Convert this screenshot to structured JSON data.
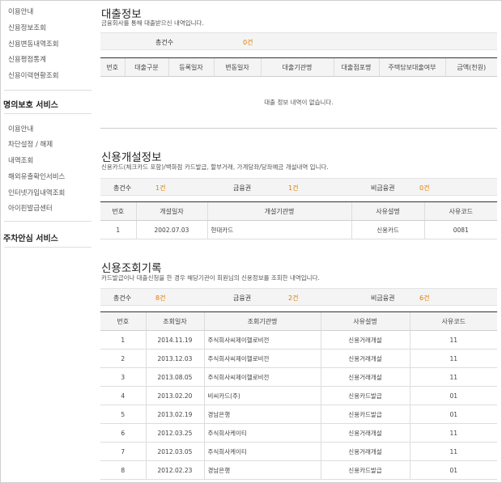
{
  "sidebar": {
    "items_top": [
      "이용안내",
      "신용정보조회",
      "신용변동내역조회",
      "신용평점통계",
      "신용이력현황조회"
    ],
    "section2_title": "명의보호 서비스",
    "items_mid": [
      "이용안내",
      "차단설정 / 해제",
      "내역조회",
      "해외유출확인서비스",
      "인터넷가입내역조회",
      "아이핀발급센터"
    ],
    "section3_title": "주차안심 서비스"
  },
  "loan": {
    "title": "대출정보",
    "desc": "금융회사를 통해 대출받으신 내역입니다.",
    "total_label": "총건수",
    "total_value": "0건",
    "headers": [
      "번호",
      "대출구분",
      "등록일자",
      "변동일자",
      "대출기관명",
      "대출점포명",
      "주택담보대출여부",
      "금액(천원)"
    ],
    "empty_text": "대출 정보 내역이 없습니다."
  },
  "account": {
    "title": "신용개설정보",
    "desc": "신용카드(체크카드 포함)/백화점 카드발급, 할부거래, 가계당좌/당좌예금 개설내역 입니다.",
    "total_label": "총건수",
    "total_value": "1건",
    "fin_label": "금융권",
    "fin_value": "1건",
    "nonfin_label": "비금융권",
    "nonfin_value": "0건",
    "headers": [
      "번호",
      "개설일자",
      "개설기관명",
      "사유설명",
      "사유코드"
    ],
    "rows": [
      [
        "1",
        "2002.07.03",
        "현대카드",
        "신용카드",
        "0081"
      ]
    ]
  },
  "inquiry": {
    "title": "신용조회기록",
    "desc": "카드발급이나 대출신청을 한 경우 해당기관이 회원님의 신용정보를 조회한 내역입니다.",
    "total_label": "총건수",
    "total_value": "8건",
    "fin_label": "금융권",
    "fin_value": "2건",
    "nonfin_label": "비금융권",
    "nonfin_value": "6건",
    "headers": [
      "번호",
      "조회일자",
      "조회기관명",
      "사유설명",
      "사유코드"
    ],
    "rows": [
      [
        "1",
        "2014.11.19",
        "주식회사씨제이헬로비전",
        "신용거래개설",
        "11"
      ],
      [
        "2",
        "2013.12.03",
        "주식회사씨제이헬로비전",
        "신용거래개설",
        "11"
      ],
      [
        "3",
        "2013.08.05",
        "주식회사씨제이헬로비전",
        "신용거래개설",
        "11"
      ],
      [
        "4",
        "2013.02.20",
        "비씨카드(주)",
        "신용카드발급",
        "01"
      ],
      [
        "5",
        "2013.02.19",
        "경남은행",
        "신용카드발급",
        "01"
      ],
      [
        "6",
        "2012.03.25",
        "주식회사케이티",
        "신용거래개설",
        "11"
      ],
      [
        "7",
        "2012.03.05",
        "주식회사케이티",
        "신용거래개설",
        "11"
      ],
      [
        "8",
        "2012.02.23",
        "경남은행",
        "신용카드발급",
        "01"
      ]
    ]
  }
}
